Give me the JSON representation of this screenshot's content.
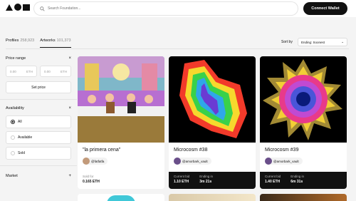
{
  "header": {
    "search_placeholder": "Search Foundation...",
    "connect_label": "Connect Wallet"
  },
  "tabs": [
    {
      "label": "Profiles",
      "count": "258,923"
    },
    {
      "label": "Artworks",
      "count": "101,373"
    }
  ],
  "sort": {
    "label": "Sort by",
    "value": "Ending: Soonest"
  },
  "sidebar": {
    "price_range": {
      "title": "Price range",
      "min_placeholder": "0.00",
      "max_placeholder": "0.00",
      "unit": "ETH",
      "button": "Set price"
    },
    "availability": {
      "title": "Availability",
      "options": [
        "All",
        "Available",
        "Sold"
      ],
      "selected": "All"
    },
    "market": {
      "title": "Market"
    }
  },
  "cards": [
    {
      "title": "\"la primera cena\"",
      "creator": "@fatfatfa",
      "footer_label1": "Sold for",
      "footer_value1": "0.165 ETH"
    },
    {
      "title": "Microcosm #38",
      "creator": "@amorbark_vault",
      "footer_label1": "Current bid",
      "footer_value1": "1.10 ETH",
      "footer_label2": "Ending in",
      "footer_value2": "3m  21s"
    },
    {
      "title": "Microcosm #39",
      "creator": "@amorbark_vault",
      "footer_label1": "Current bid",
      "footer_value1": "1.40 ETH",
      "footer_label2": "Ending in",
      "footer_value2": "6m  31s"
    }
  ],
  "colors": {
    "accent": "#111111",
    "background": "#f4f4f4"
  }
}
